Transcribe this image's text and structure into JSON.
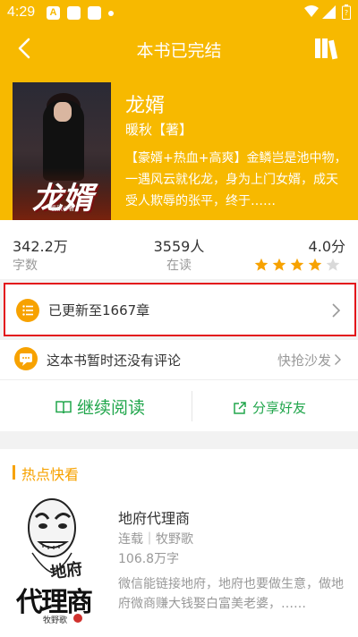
{
  "status": {
    "time": "4:29",
    "notif_letter": "A"
  },
  "header": {
    "title": "本书已完结"
  },
  "book": {
    "name": "龙婿",
    "author": "暖秋【著】",
    "description": "【豪婿+热血+高爽】金鳞岂是池中物，一遇风云就化龙，身为上门女婿，成天受人欺辱的张平，终于……",
    "cover_title": "龙婿",
    "cover_author": "暖秋◎著"
  },
  "stats": {
    "words_value": "342.2万",
    "words_label": "字数",
    "readers_value": "3559人",
    "readers_label": "在读",
    "score_value": "4.0分",
    "rating": 4,
    "rating_max": 5
  },
  "update": {
    "text": "已更新至1667章"
  },
  "comments": {
    "text": "这本书暂时还没有评论",
    "sofa": "快抢沙发"
  },
  "actions": {
    "continue": "继续阅读",
    "share": "分享好友"
  },
  "hot": {
    "section_title": "热点快看",
    "book": {
      "name": "地府代理商",
      "meta": "连载｜牧野歌",
      "words": "106.8万字",
      "description": "微信能链接地府，地府也要做生意，做地府微商赚大钱娶白富美老婆，……",
      "cover_text_top": "地府",
      "cover_text_main": "代理商",
      "cover_author": "牧野歌"
    }
  },
  "colors": {
    "brand": "#f7b900",
    "accent": "#f7a200",
    "green": "#21a64c",
    "highlight": "#e3141b"
  }
}
